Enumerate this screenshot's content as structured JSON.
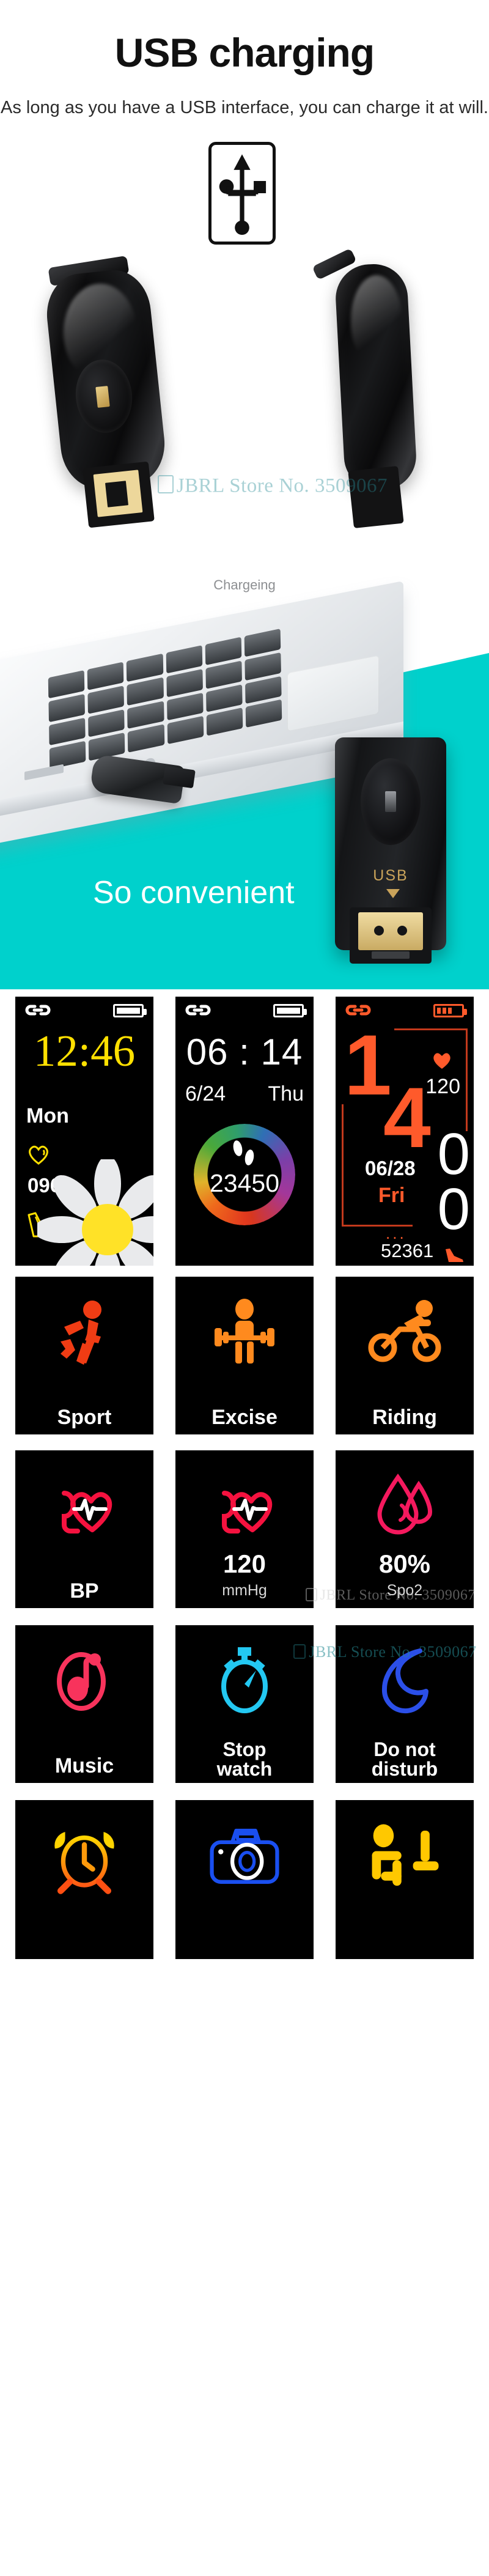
{
  "usb_section": {
    "title": "USB charging",
    "subtitle": "As long as you have a USB interface, you can charge it at will.",
    "badge_icon": "usb-icon",
    "watermark": "JBRL Store No. 3509067"
  },
  "convenience_section": {
    "charging_label": "Chargeing",
    "headline": "So convenient",
    "dongle_port_label": "USB",
    "dongle_arrow_icon": "arrow-down-icon",
    "teal_color": "#00d1cc"
  },
  "watch_faces": [
    {
      "name": "yellow-daisy-face",
      "link_icon": "link-icon",
      "battery_icon": "battery-icon",
      "time": "12:46",
      "weekday": "Mon",
      "heart_icon": "heart-outline-icon",
      "heart_rate": "096",
      "shoe_icon": "shoe-icon",
      "accent": "#ffe000"
    },
    {
      "name": "rainbow-ring-face",
      "link_icon": "link-icon",
      "battery_icon": "battery-icon",
      "time": "06 : 14",
      "date": "6/24",
      "weekday": "Thu",
      "footprints_icon": "footprints-icon",
      "steps": "23450",
      "accent": "#ffffff"
    },
    {
      "name": "orange-block-face",
      "link_icon": "link-icon",
      "battery_icon": "battery-icon",
      "hour_digit_1": "1",
      "hour_digit_2": "4",
      "minute_digit_1": "0",
      "minute_digit_2": "0",
      "heart_icon": "heart-filled-icon",
      "heart_rate": "120",
      "date": "06/28",
      "weekday": "Fri",
      "steps": "52361",
      "shoe_icon": "shoe-icon",
      "dots": "...",
      "accent": "#ff5a2b"
    }
  ],
  "feature_rows": [
    {
      "row": "sports",
      "tiles": [
        {
          "label": "Sport",
          "icon": "running-person-icon",
          "color": "#f03c14"
        },
        {
          "label": "Excise",
          "icon": "weightlifting-person-icon",
          "color": "#ff8a1e"
        },
        {
          "label": "Riding",
          "icon": "cycling-person-icon",
          "color": "#ff8a1e"
        }
      ]
    },
    {
      "row": "health",
      "tiles": [
        {
          "label": "BP",
          "icon": "blood-pressure-heart-icon",
          "color": "#f5123f"
        },
        {
          "value": "120",
          "unit": "mmHg",
          "icon": "blood-pressure-heart-icon",
          "color": "#f5123f"
        },
        {
          "value": "80%",
          "unit": "Spo2",
          "icon": "blood-drop-icon",
          "color": "#f5195e"
        }
      ]
    },
    {
      "row": "utilities",
      "tiles": [
        {
          "label": "Music",
          "icon": "music-note-icon",
          "color": "#f8335c"
        },
        {
          "label": "Stop\nwatch",
          "icon": "stopwatch-icon",
          "color": "#23c8f2"
        },
        {
          "label": "Do not\ndisturb",
          "icon": "moon-icon",
          "color": "#2b4fe8"
        }
      ]
    },
    {
      "row": "tools",
      "tiles": [
        {
          "label": "",
          "icon": "alarm-clock-icon",
          "color": "#ffd400"
        },
        {
          "label": "",
          "icon": "camera-icon",
          "color": "#1a4ff0"
        },
        {
          "label": "",
          "icon": "sedentary-reminder-icon",
          "color": "#ffc800"
        }
      ]
    }
  ]
}
